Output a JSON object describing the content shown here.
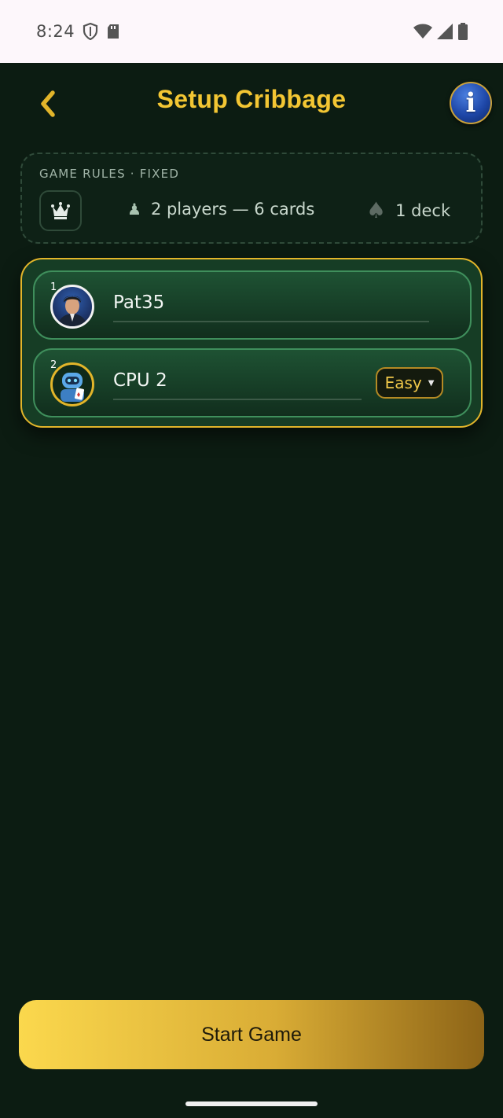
{
  "status_bar": {
    "time": "8:24",
    "icons_left": [
      "shield-icon",
      "sd-card-icon"
    ],
    "icons_right": [
      "wifi-icon",
      "signal-icon",
      "battery-icon"
    ]
  },
  "header": {
    "title": "Setup Cribbage",
    "back_icon": "chevron-left-icon",
    "info_label": "i"
  },
  "rules": {
    "label": "GAME RULES · FIXED",
    "icon": "crown-icon",
    "players_text": "2 players — 6 cards",
    "deck_text": "1 deck"
  },
  "players": [
    {
      "seat": "1",
      "name": "Pat35",
      "avatar": "user-avatar"
    },
    {
      "seat": "2",
      "name": "CPU 2",
      "avatar": "robot-avatar",
      "difficulty": "Easy"
    }
  ],
  "start_button": {
    "label": "Start Game"
  },
  "colors": {
    "background": "#0c1c12",
    "accent_gold": "#f3c633",
    "panel_green": "#163d25"
  }
}
